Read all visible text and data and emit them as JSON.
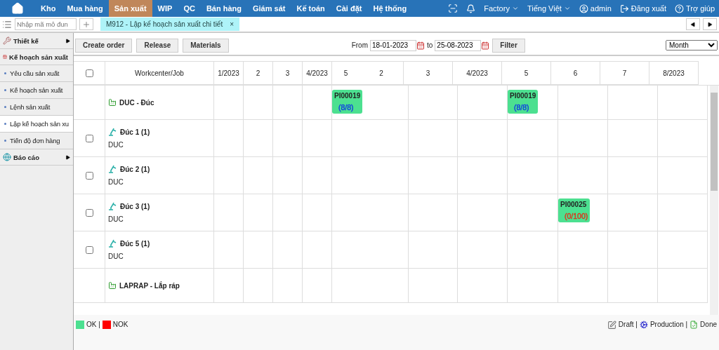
{
  "nav": {
    "items": [
      {
        "label": "Kho",
        "selected": false
      },
      {
        "label": "Mua hàng",
        "selected": false
      },
      {
        "label": "Sản xuất",
        "selected": true
      },
      {
        "label": "WIP",
        "selected": false
      },
      {
        "label": "QC",
        "selected": false
      },
      {
        "label": "Bán hàng",
        "selected": false
      },
      {
        "label": "Giám sát",
        "selected": false
      },
      {
        "label": "Kế toán",
        "selected": false
      },
      {
        "label": "Cài đặt",
        "selected": false
      },
      {
        "label": "Hệ thống",
        "selected": false
      }
    ],
    "factory": "Factory",
    "language": "Tiếng Việt",
    "user": "admin",
    "logout": "Đăng xuất",
    "help": "Trợ giúp"
  },
  "tabbar": {
    "placeholder": "Nhập mã mô đun",
    "tabs": [
      {
        "label": "M912 - Lập kế hoạch sản xuất chi tiết",
        "close": "×"
      }
    ]
  },
  "sidebar": {
    "items": [
      {
        "label": "Thiết kế",
        "kind": "tools",
        "expanded": false
      },
      {
        "label": "Kế hoạch sản xuất",
        "kind": "calendar",
        "expanded": true,
        "children": [
          {
            "label": "Yêu cầu sản xuất",
            "selected": false
          },
          {
            "label": "Kế hoạch sản xuất",
            "selected": false
          },
          {
            "label": "Lệnh sản xuất",
            "selected": false
          },
          {
            "label": "Lập kế hoạch sản xu",
            "selected": true
          },
          {
            "label": "Tiến độ đơn hàng",
            "selected": false
          }
        ]
      },
      {
        "label": "Báo cáo",
        "kind": "globe",
        "expanded": false
      }
    ]
  },
  "toolbar": {
    "buttons": [
      "Create order",
      "Release",
      "Materials"
    ],
    "from_label": "From",
    "from": "18-01-2023",
    "to_label": "to",
    "to": "25-08-2023",
    "filter": "Filter",
    "period": "Month"
  },
  "table": {
    "select_all": false,
    "columns": [
      "Workcenter/Job",
      "1/2023",
      "2",
      "3",
      "4/2023",
      "5",
      "2",
      "3",
      "4/2023",
      "5",
      "6",
      "7",
      "8/2023"
    ],
    "rows": [
      {
        "kind": "workcenter",
        "name": "DUC - Đúc",
        "cells": [
          null,
          null,
          null,
          null,
          {
            "code": "PI00019",
            "count": "(8/8)",
            "color": "#1040e0"
          },
          null,
          null,
          {
            "code": "PI00019",
            "count": "(8/8)",
            "color": "#1040e0"
          },
          null,
          null,
          null
        ]
      },
      {
        "kind": "machine",
        "name": "Đúc 1 (1)",
        "group": "DUC",
        "checked": false
      },
      {
        "kind": "machine",
        "name": "Đúc 2 (1)",
        "group": "DUC",
        "checked": false
      },
      {
        "kind": "machine",
        "name": "Đúc 3 (1)",
        "group": "DUC",
        "checked": false,
        "cells": [
          null,
          null,
          null,
          null,
          null,
          null,
          null,
          null,
          {
            "code": "PI00025",
            "count": "(0/100)",
            "color": "#e0301a"
          },
          null,
          null
        ]
      },
      {
        "kind": "machine",
        "name": "Đúc 5 (1)",
        "group": "DUC",
        "checked": false
      },
      {
        "kind": "workcenter",
        "name": "LAPRAP - Lắp ráp"
      }
    ]
  },
  "legend": {
    "colors": [
      {
        "label": "OK |",
        "color": "#4ce090"
      },
      {
        "label": "NOK",
        "color": "#ff0000"
      }
    ],
    "states": [
      {
        "label": "Draft |",
        "kind": "draft"
      },
      {
        "label": "Production |",
        "kind": "production"
      },
      {
        "label": "Done",
        "kind": "done"
      }
    ]
  }
}
